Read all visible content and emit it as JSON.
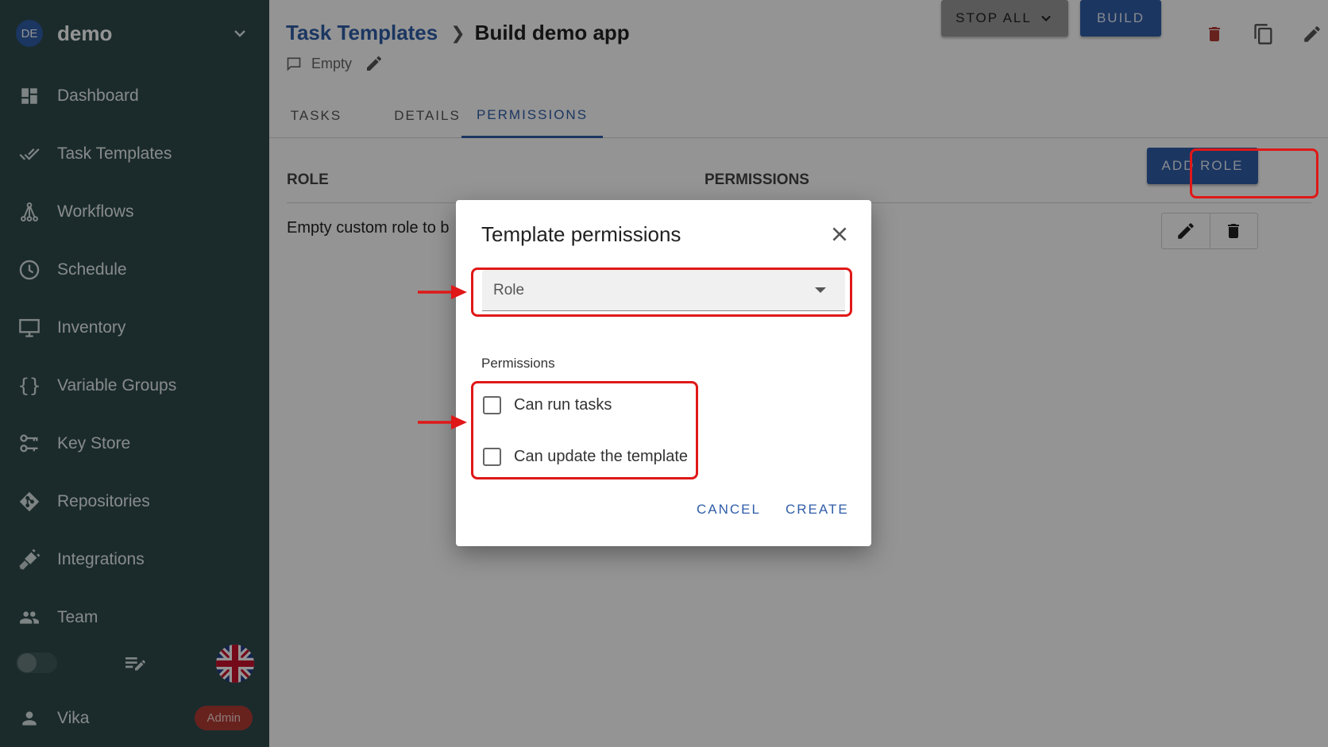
{
  "sidebar": {
    "project": {
      "initials": "DE",
      "name": "demo"
    },
    "items": [
      {
        "label": "Dashboard",
        "icon": "dashboard-icon"
      },
      {
        "label": "Task Templates",
        "icon": "done-all-icon"
      },
      {
        "label": "Workflows",
        "icon": "workflow-icon"
      },
      {
        "label": "Schedule",
        "icon": "clock-icon"
      },
      {
        "label": "Inventory",
        "icon": "monitor-icon"
      },
      {
        "label": "Variable Groups",
        "icon": "braces-icon"
      },
      {
        "label": "Key Store",
        "icon": "key-icon"
      },
      {
        "label": "Repositories",
        "icon": "git-icon"
      },
      {
        "label": "Integrations",
        "icon": "plug-icon"
      },
      {
        "label": "Team",
        "icon": "team-icon"
      }
    ],
    "user": {
      "name": "Vika",
      "badge": "Admin"
    }
  },
  "header": {
    "breadcrumb_parent": "Task Templates",
    "breadcrumb_current": "Build demo app",
    "description": "Empty",
    "stop_all_label": "STOP ALL",
    "build_label": "BUILD"
  },
  "tabs": [
    {
      "label": "TASKS"
    },
    {
      "label": "DETAILS"
    },
    {
      "label": "PERMISSIONS"
    }
  ],
  "table": {
    "headers": {
      "role": "ROLE",
      "permissions": "PERMISSIONS"
    },
    "add_role_label": "ADD ROLE",
    "rows": [
      {
        "role": "Empty custom role to b"
      }
    ]
  },
  "dialog": {
    "title": "Template permissions",
    "role_placeholder": "Role",
    "permissions_label": "Permissions",
    "options": [
      {
        "label": "Can run tasks",
        "checked": false
      },
      {
        "label": "Can update the template",
        "checked": false
      }
    ],
    "cancel_label": "CANCEL",
    "create_label": "CREATE"
  },
  "colors": {
    "sidebar_bg": "#2f4a4c",
    "accent": "#2f5da8",
    "danger": "#b23b34",
    "highlight": "#e01818"
  }
}
